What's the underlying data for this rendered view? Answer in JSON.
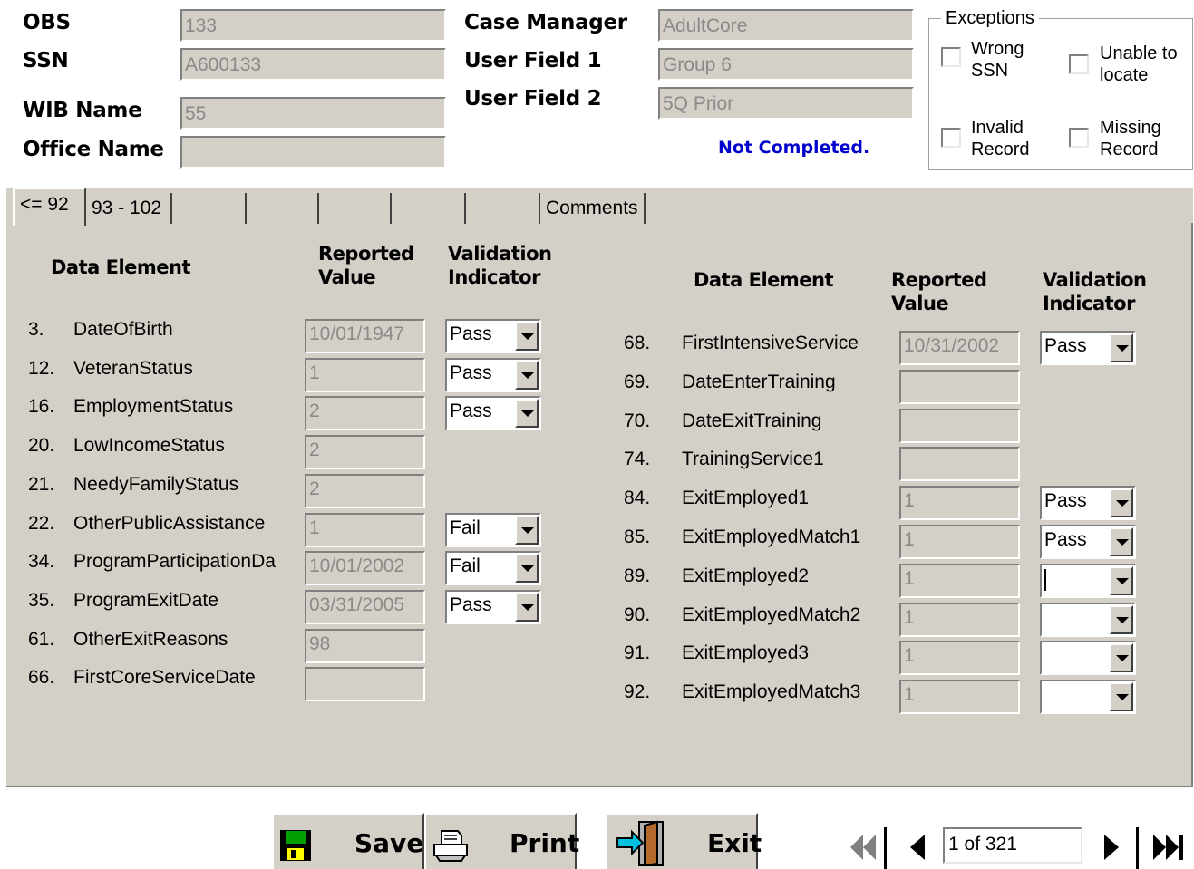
{
  "header": {
    "obs_label": "OBS",
    "obs_value": "133",
    "ssn_label": "SSN",
    "ssn_value": "A600133",
    "wib_label": "WIB Name",
    "wib_value": "55",
    "office_label": "Office Name",
    "office_value": "",
    "case_manager_label": "Case Manager",
    "case_manager_value": "AdultCore",
    "user_field1_label": "User Field 1",
    "user_field1_value": "Group 6",
    "user_field2_label": "User Field 2",
    "user_field2_value": "5Q Prior",
    "status": "Not Completed."
  },
  "exceptions": {
    "title": "Exceptions",
    "wrong_ssn_1": "Wrong",
    "wrong_ssn_2": "SSN",
    "unable_1": "Unable to",
    "unable_2": "locate",
    "invalid_1": "Invalid",
    "invalid_2": "Record",
    "missing_1": "Missing",
    "missing_2": "Record"
  },
  "tabs": [
    "<= 92",
    "93 - 102",
    "",
    "",
    "",
    "",
    "",
    "Comments"
  ],
  "columns": {
    "data_element": "Data Element",
    "reported_1": "Reported",
    "reported_2": "Value",
    "validation_1": "Validation",
    "validation_2": "Indicator"
  },
  "left_rows": [
    {
      "num": "3.",
      "name": "DateOfBirth",
      "value": "10/01/1947",
      "indicator": "Pass"
    },
    {
      "num": "12.",
      "name": "VeteranStatus",
      "value": "1",
      "indicator": "Pass"
    },
    {
      "num": "16.",
      "name": "EmploymentStatus",
      "value": "2",
      "indicator": "Pass"
    },
    {
      "num": "20.",
      "name": "LowIncomeStatus",
      "value": "2",
      "indicator": null
    },
    {
      "num": "21.",
      "name": "NeedyFamilyStatus",
      "value": "2",
      "indicator": null
    },
    {
      "num": "22.",
      "name": "OtherPublicAssistance",
      "value": "1",
      "indicator": "Fail"
    },
    {
      "num": "34.",
      "name": "ProgramParticipationDa",
      "value": "10/01/2002",
      "indicator": "Fail"
    },
    {
      "num": "35.",
      "name": "ProgramExitDate",
      "value": "03/31/2005",
      "indicator": "Pass"
    },
    {
      "num": "61.",
      "name": "OtherExitReasons",
      "value": "98",
      "indicator": null
    },
    {
      "num": "66.",
      "name": "FirstCoreServiceDate",
      "value": "",
      "indicator": null
    }
  ],
  "right_rows": [
    {
      "num": "68.",
      "name": "FirstIntensiveService",
      "value": "10/31/2002",
      "indicator": "Pass"
    },
    {
      "num": "69.",
      "name": "DateEnterTraining",
      "value": "",
      "indicator": null
    },
    {
      "num": "70.",
      "name": "DateExitTraining",
      "value": "",
      "indicator": null
    },
    {
      "num": "74.",
      "name": "TrainingService1",
      "value": "",
      "indicator": null
    },
    {
      "num": "84.",
      "name": "ExitEmployed1",
      "value": "1",
      "indicator": "Pass"
    },
    {
      "num": "85.",
      "name": "ExitEmployedMatch1",
      "value": "1",
      "indicator": "Pass"
    },
    {
      "num": "89.",
      "name": "ExitEmployed2",
      "value": "1",
      "indicator": ""
    },
    {
      "num": "90.",
      "name": "ExitEmployedMatch2",
      "value": "1",
      "indicator": ""
    },
    {
      "num": "91.",
      "name": "ExitEmployed3",
      "value": "1",
      "indicator": ""
    },
    {
      "num": "92.",
      "name": "ExitEmployedMatch3",
      "value": "1",
      "indicator": ""
    }
  ],
  "buttons": {
    "save": "Save",
    "print": "Print",
    "exit": "Exit"
  },
  "navigation": {
    "record": "1 of 321"
  },
  "icons": {
    "save": "floppy-disk-icon",
    "print": "printer-icon",
    "exit": "exit-door-icon",
    "first": "first-record-icon",
    "prev": "previous-record-icon",
    "next": "next-record-icon",
    "last": "last-record-icon"
  },
  "colors": {
    "panel": "#d4d0c8",
    "status": "#0000cc"
  }
}
